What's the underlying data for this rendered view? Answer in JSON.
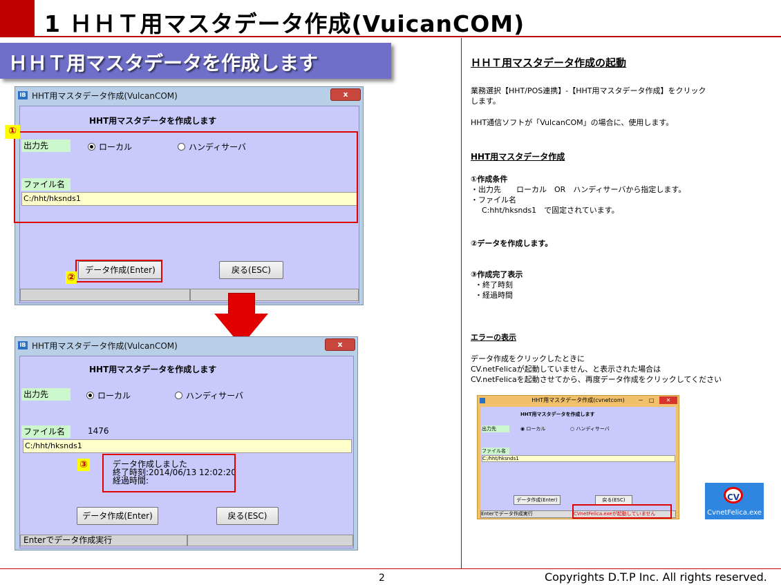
{
  "header": {
    "title": "1 ＨＨＴ用マスタデータ作成(VuicanCOM)",
    "subtitle": "ＨＨＴ用マスタデータを作成します"
  },
  "window1": {
    "title": "HHT用マスタデータ作成(VulcanCOM)",
    "close": "x",
    "heading": "HHT用マスタデータを作成します",
    "output_label": "出力先",
    "radio_local": "ローカル",
    "radio_handy": "ハンディサーバ",
    "file_label": "ファイル名",
    "file_value": "C:/hht/hksnds1",
    "btn_create": "データ作成(Enter)",
    "btn_back": "戻る(ESC)"
  },
  "window2": {
    "title": "HHT用マスタデータ作成(VulcanCOM)",
    "close": "x",
    "heading": "HHT用マスタデータを作成します",
    "output_label": "出力先",
    "radio_local": "ローカル",
    "radio_handy": "ハンディサーバ",
    "file_label": "ファイル名",
    "file_count": "1476",
    "file_value": "C:/hht/hksnds1",
    "result_line1": "データ作成しました",
    "result_line2": "終了時刻:2014/06/13 12:02:20",
    "result_line3": "経過時間:",
    "btn_create": "データ作成(Enter)",
    "btn_back": "戻る(ESC)",
    "status": "Enterでデータ作成実行"
  },
  "markers": {
    "m1": "①",
    "m2": "②",
    "m3": "③"
  },
  "right": {
    "startup_heading": "ＨＨＴ用マスタデータ作成の起動",
    "p1_line1": "業務選択【HHT/POS連携】-【HHT用マスタデータ作成】をクリック",
    "p1_line2": "します。",
    "p2": "HHT通信ソフトが「VulcanCOM」の場合に、使用します。",
    "section_heading": "HHT用マスタデータ作成",
    "cond_title": "①作成条件",
    "cond_line1": "・出力先　　ローカル　OR　ハンディサーバから指定します。",
    "cond_line2": "・ファイル名",
    "cond_line3": "C:hht/hksnds1　で固定されています。",
    "step2": "②データを作成します。",
    "step3_title": "③作成完了表示",
    "step3_line1": "・終了時刻",
    "step3_line2": "・経過時間",
    "error_heading": "エラーの表示",
    "err_line1": "データ作成をクリックしたときに",
    "err_line2": "CV.netFelicaが起動していません、と表示された場合は",
    "err_line3": "CV.netFelicaを起動させてから、再度データ作成をクリックしてください"
  },
  "small_window": {
    "title": "HHT用マスタデータ作成(cvnetcom)",
    "controls": "－　□",
    "heading": "HHT用マスタデータを作成します",
    "output_label": "出力先",
    "radio_local": "ローカル",
    "radio_handy": "ハンディサーバ",
    "file_label": "ファイル名",
    "file_value": "C:/hht/hksnds1",
    "btn_create": "データ作成(Enter)",
    "btn_back": "戻る(ESC)",
    "status_left": "Enterでデータ作成実行",
    "status_error": "CVnetFelica.exeが起動していません"
  },
  "cv_icon": {
    "logo": "CV",
    "label": "CvnetFelica.exe"
  },
  "footer": {
    "page": "2",
    "copyright": "Copyrights D.T.P Inc. All rights reserved."
  }
}
